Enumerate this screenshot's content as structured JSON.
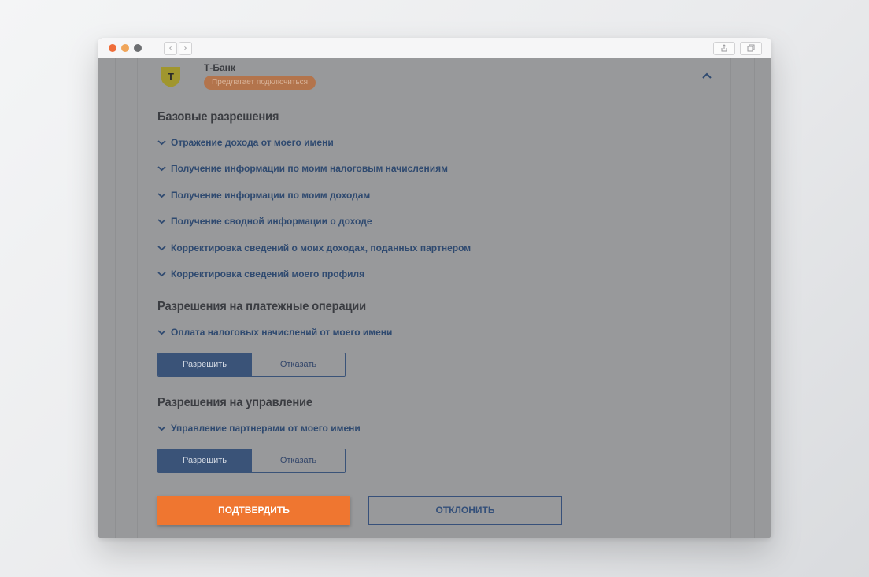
{
  "browser": {
    "back_glyph": "‹",
    "forward_glyph": "›"
  },
  "bank": {
    "name": "Т-Банк",
    "status_badge": "Предлагает подключиться",
    "logo_letter": "Т"
  },
  "sections": {
    "base": {
      "title": "Базовые разрешения",
      "items": [
        "Отражение дохода от моего имени",
        "Получение информации по моим налоговым начислениям",
        "Получение информации по моим доходам",
        "Получение сводной информации о доходе",
        "Корректировка сведений о моих доходах, поданных партнером",
        "Корректировка сведений моего профиля"
      ]
    },
    "payments": {
      "title": "Разрешения на платежные операции",
      "items": [
        "Оплата налоговых начислений от моего имени"
      ],
      "allow_label": "Разрешить",
      "deny_label": "Отказать"
    },
    "management": {
      "title": "Разрешения на управление",
      "items": [
        "Управление партнерами от моего имени"
      ],
      "allow_label": "Разрешить",
      "deny_label": "Отказать"
    }
  },
  "actions": {
    "confirm_label": "ПОДТВЕРДИТЬ",
    "reject_label": "ОТКЛОНИТЬ"
  },
  "colors": {
    "accent_orange": "#ef7630",
    "primary_blue": "#3a5378",
    "overlay_gray": "#98999b"
  }
}
